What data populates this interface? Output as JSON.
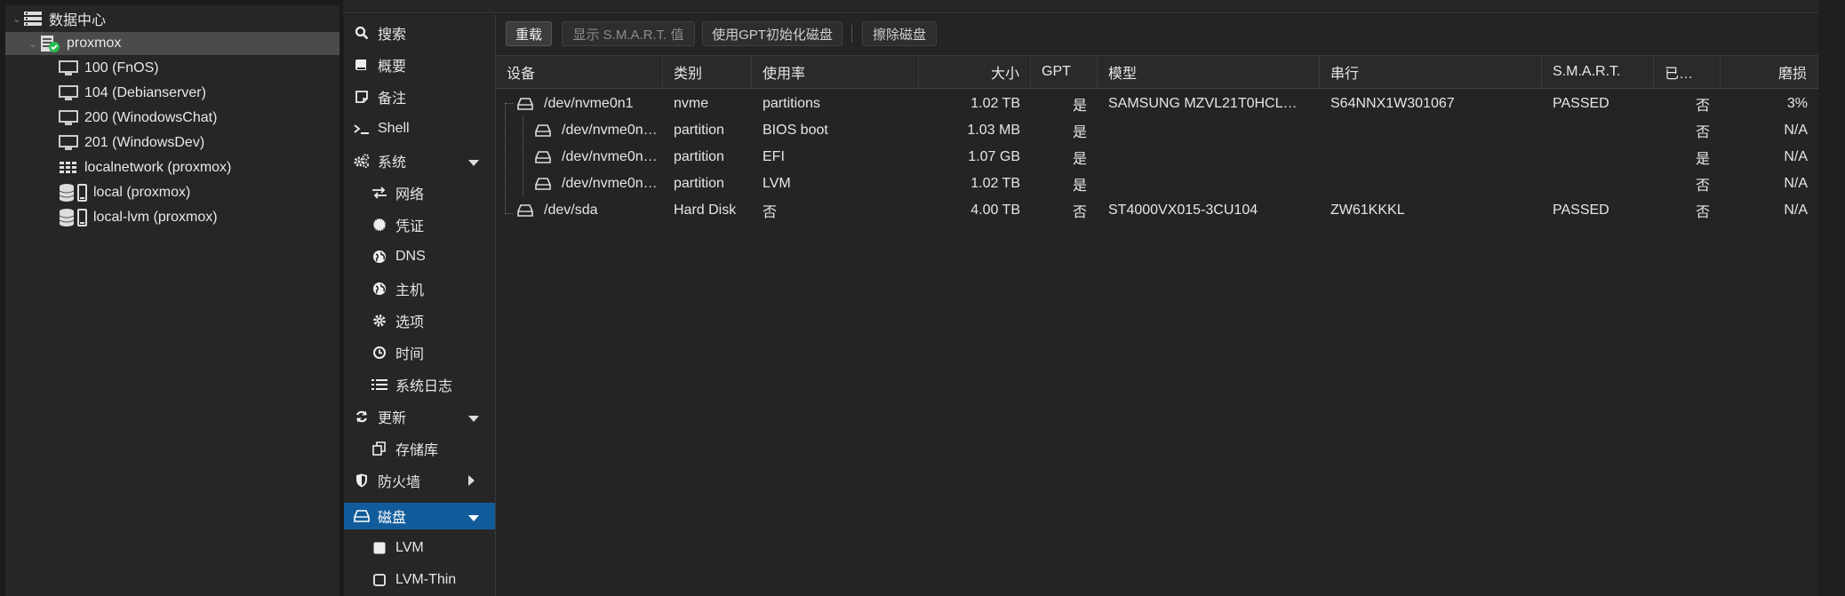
{
  "resource_tree": {
    "datacenter": "数据中心",
    "node": "proxmox",
    "items": [
      {
        "label": "100 (FnOS)",
        "icon": "vm-icon"
      },
      {
        "label": "104 (Debianserver)",
        "icon": "vm-icon"
      },
      {
        "label": "200 (WinodowsChat)",
        "icon": "vm-icon"
      },
      {
        "label": "201 (WindowsDev)",
        "icon": "vm-icon"
      },
      {
        "label": "localnetwork (proxmox)",
        "icon": "sdn-icon"
      },
      {
        "label": "local (proxmox)",
        "icon": "storage-icon"
      },
      {
        "label": "local-lvm (proxmox)",
        "icon": "storage-icon"
      }
    ]
  },
  "node_menu": {
    "items": [
      {
        "label": "搜索",
        "icon": "search-icon"
      },
      {
        "label": "概要",
        "icon": "book-icon"
      },
      {
        "label": "备注",
        "icon": "note-icon"
      },
      {
        "label": "Shell",
        "icon": "terminal-icon"
      },
      {
        "label": "系统",
        "icon": "cogs-icon"
      },
      {
        "label": "网络",
        "icon": "network-icon"
      },
      {
        "label": "凭证",
        "icon": "certificate-icon"
      },
      {
        "label": "DNS",
        "icon": "globe-icon"
      },
      {
        "label": "主机",
        "icon": "globe-icon"
      },
      {
        "label": "选项",
        "icon": "gear-icon"
      },
      {
        "label": "时间",
        "icon": "clock-icon"
      },
      {
        "label": "系统日志",
        "icon": "list-icon"
      },
      {
        "label": "更新",
        "icon": "refresh-icon"
      },
      {
        "label": "存储库",
        "icon": "copy-icon"
      },
      {
        "label": "防火墙",
        "icon": "shield-icon"
      },
      {
        "label": "磁盘",
        "icon": "hdd-icon"
      },
      {
        "label": "LVM",
        "icon": "square-icon"
      },
      {
        "label": "LVM-Thin",
        "icon": "square-outline-icon"
      }
    ]
  },
  "toolbar": {
    "reload": "重载",
    "show_smart": "显示 S.M.A.R.T. 值",
    "init_gpt": "使用GPT初始化磁盘",
    "wipe": "擦除磁盘"
  },
  "grid": {
    "columns": [
      "设备",
      "类别",
      "使用率",
      "大小",
      "GPT",
      "模型",
      "串行",
      "S.M.A.R.T.",
      "已…",
      "磨损"
    ],
    "rows": [
      {
        "device": "/dev/nvme0n1",
        "type": "nvme",
        "usage": "partitions",
        "size": "1.02 TB",
        "gpt": "是",
        "model": "SAMSUNG MZVL21T0HCL…",
        "serial": "S64NNX1W301067",
        "smart": "PASSED",
        "mounted": "否",
        "wear": "3%"
      },
      {
        "device": "/dev/nvme0n…",
        "type": "partition",
        "usage": "BIOS boot",
        "size": "1.03 MB",
        "gpt": "是",
        "model": "",
        "serial": "",
        "smart": "",
        "mounted": "否",
        "wear": "N/A"
      },
      {
        "device": "/dev/nvme0n…",
        "type": "partition",
        "usage": "EFI",
        "size": "1.07 GB",
        "gpt": "是",
        "model": "",
        "serial": "",
        "smart": "",
        "mounted": "是",
        "wear": "N/A"
      },
      {
        "device": "/dev/nvme0n…",
        "type": "partition",
        "usage": "LVM",
        "size": "1.02 TB",
        "gpt": "是",
        "model": "",
        "serial": "",
        "smart": "",
        "mounted": "否",
        "wear": "N/A"
      },
      {
        "device": "/dev/sda",
        "type": "Hard Disk",
        "usage": "否",
        "size": "4.00 TB",
        "gpt": "否",
        "model": "ST4000VX015-3CU104",
        "serial": "ZW61KKKL",
        "smart": "PASSED",
        "mounted": "否",
        "wear": "N/A"
      }
    ]
  },
  "colors": {
    "selected_menu": "#125c9b",
    "status_ok": "#21bf4b",
    "background": "#242424"
  }
}
